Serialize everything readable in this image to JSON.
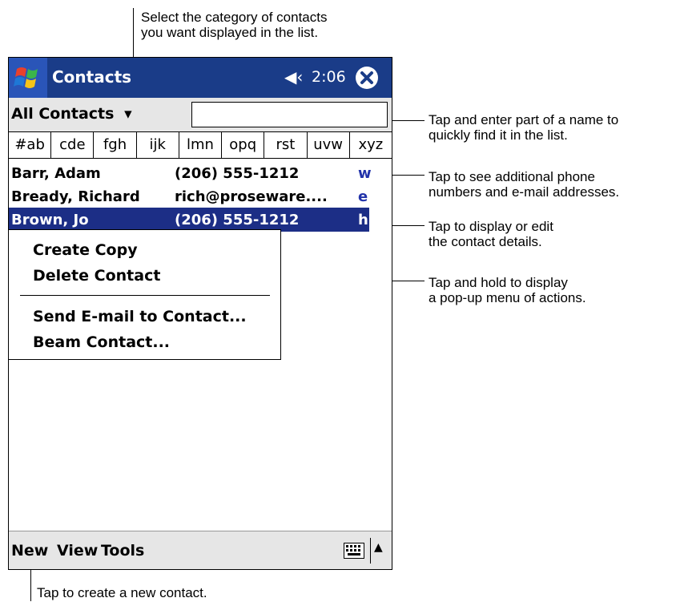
{
  "callouts": {
    "category_line1": "Select the category of contacts",
    "category_line2": "you want displayed in the list.",
    "find_line1": "Tap and enter part of a name to",
    "find_line2": "quickly find it in the list.",
    "phone_line1": "Tap to see additional phone",
    "phone_line2": "numbers and e-mail addresses.",
    "details_line1": "Tap to display or edit",
    "details_line2": "the contact details.",
    "hold_line1": "Tap and hold to display",
    "hold_line2": "a pop-up menu of actions.",
    "new_line": "Tap to create a new contact."
  },
  "device": {
    "title": "Contacts",
    "clock": "2:06",
    "speaker_icon": "◀‹",
    "category_label": "All Contacts",
    "category_arrow": "▾",
    "search_value": "",
    "tabs": [
      "#ab",
      "cde",
      "fgh",
      "ijk",
      "lmn",
      "opq",
      "rst",
      "uvw",
      "xyz"
    ],
    "contacts": [
      {
        "name": "Barr, Adam",
        "info": "(206) 555-1212",
        "type": "w"
      },
      {
        "name": "Bready, Richard",
        "info": "rich@proseware....",
        "type": "e"
      },
      {
        "name": "Brown, Jo",
        "info": "(206) 555-1212",
        "type": "h"
      }
    ],
    "popup_menu": [
      "Create Copy",
      "Delete Contact",
      "Send E-mail to Contact...",
      "Beam Contact..."
    ],
    "menubar": {
      "new": "New",
      "view": "View",
      "tools": "Tools",
      "sip_arrow": "▲"
    }
  }
}
